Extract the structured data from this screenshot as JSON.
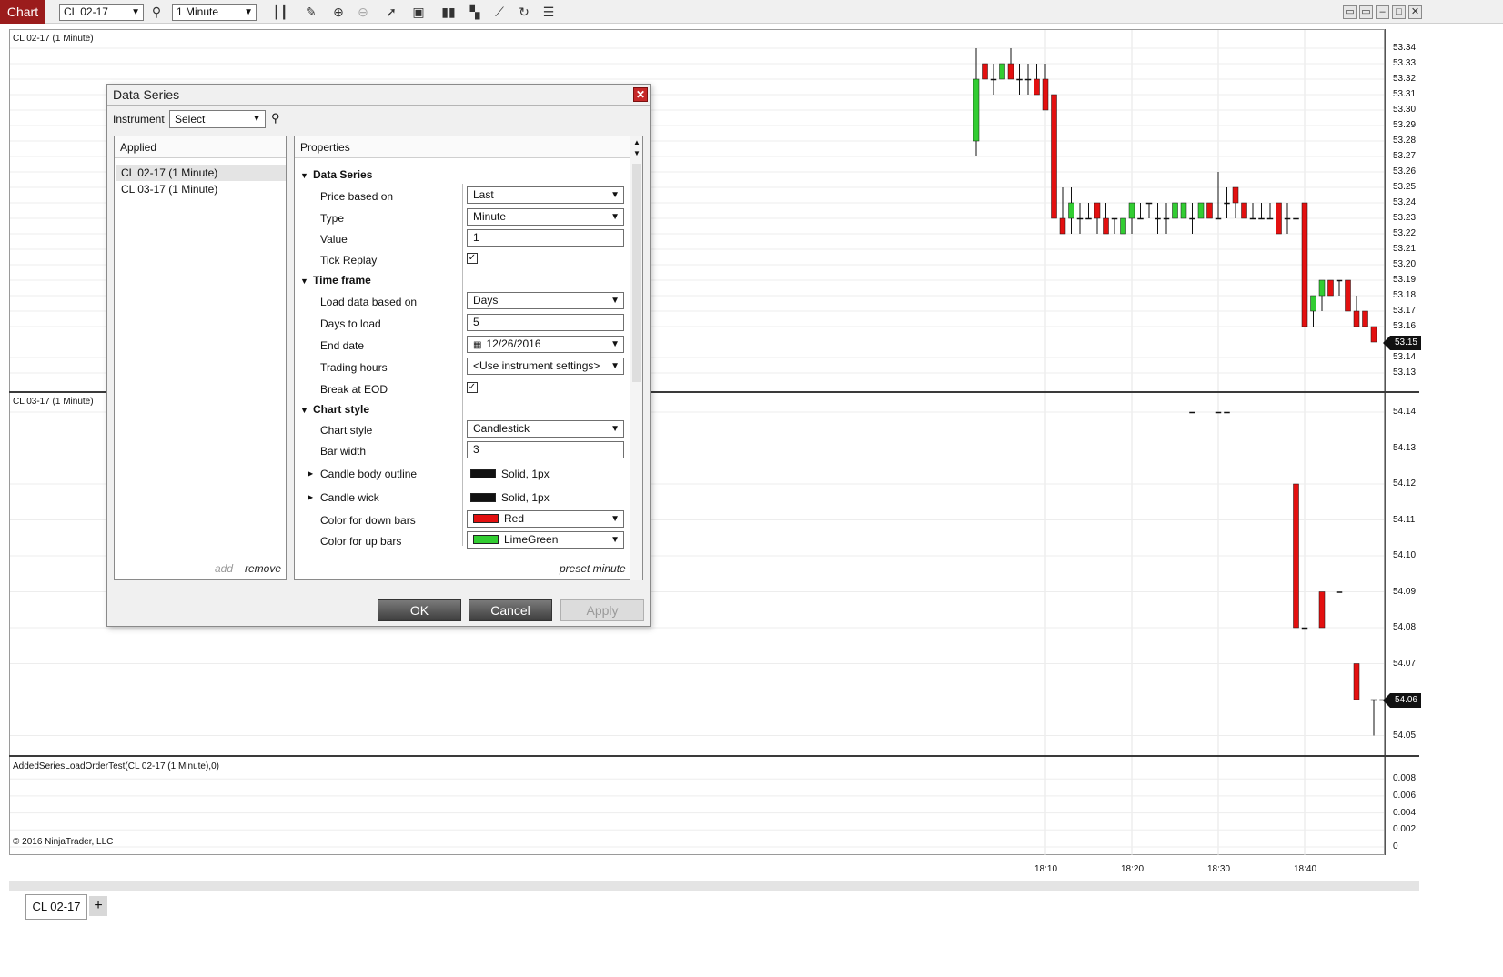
{
  "toolbar": {
    "chart_label": "Chart",
    "instrument": "CL 02-17",
    "interval": "1 Minute",
    "icons": [
      "search-icon",
      "bars-type-icon",
      "pencil-icon",
      "zoom-in-icon",
      "zoom-out-icon",
      "pointer-icon",
      "data-series-icon",
      "strategies-icon",
      "indicators-icon",
      "drawing-tools-icon",
      "reload-icon",
      "properties-icon"
    ]
  },
  "panes": {
    "pane1_label": "CL 02-17 (1 Minute)",
    "pane2_label": "CL 03-17 (1 Minute)",
    "pane3_label": "AddedSeriesLoadOrderTest(CL 02-17 (1 Minute),0)",
    "copyright": "© 2016 NinjaTrader, LLC"
  },
  "axes": {
    "pane1_ticks": [
      "53.34",
      "53.33",
      "53.32",
      "53.31",
      "53.30",
      "53.29",
      "53.28",
      "53.27",
      "53.26",
      "53.25",
      "53.24",
      "53.23",
      "53.22",
      "53.21",
      "53.20",
      "53.19",
      "53.18",
      "53.17",
      "53.16",
      "53.14",
      "53.13"
    ],
    "pane1_last": "53.15",
    "pane2_ticks": [
      "54.14",
      "54.13",
      "54.12",
      "54.11",
      "54.10",
      "54.09",
      "54.08",
      "54.07",
      "54.05"
    ],
    "pane2_last": "54.06",
    "pane3_ticks": [
      "0.008",
      "0.006",
      "0.004",
      "0.002",
      "0"
    ],
    "time_ticks": [
      "18:10",
      "18:20",
      "18:30",
      "18:40"
    ]
  },
  "chart_data": [
    {
      "type": "candlestick",
      "title": "CL 02-17 (1 Minute)",
      "ylim": [
        53.12,
        53.345
      ],
      "x": [
        "18:02",
        "18:03",
        "18:04",
        "18:05",
        "18:06",
        "18:07",
        "18:08",
        "18:09",
        "18:10",
        "18:11",
        "18:12",
        "18:13",
        "18:14",
        "18:15",
        "18:16",
        "18:17",
        "18:18",
        "18:19",
        "18:20",
        "18:21",
        "18:22",
        "18:23",
        "18:24",
        "18:25",
        "18:26",
        "18:27",
        "18:28",
        "18:29",
        "18:30",
        "18:31",
        "18:32",
        "18:33",
        "18:34",
        "18:35",
        "18:36",
        "18:37",
        "18:38",
        "18:39",
        "18:40",
        "18:41",
        "18:42",
        "18:43",
        "18:44",
        "18:45",
        "18:46",
        "18:47",
        "18:48"
      ],
      "open": [
        53.28,
        53.33,
        53.32,
        53.32,
        53.33,
        53.32,
        53.32,
        53.32,
        53.32,
        53.31,
        53.23,
        53.23,
        53.23,
        53.23,
        53.24,
        53.23,
        53.23,
        53.22,
        53.23,
        53.23,
        53.24,
        53.23,
        53.23,
        53.23,
        53.23,
        53.23,
        53.23,
        53.24,
        53.23,
        53.24,
        53.25,
        53.24,
        53.23,
        53.23,
        53.23,
        53.24,
        53.23,
        53.23,
        53.24,
        53.17,
        53.18,
        53.19,
        53.19,
        53.19,
        53.17,
        53.17,
        53.16,
        53.15,
        53.14
      ],
      "high": [
        53.34,
        53.33,
        53.33,
        53.33,
        53.34,
        53.33,
        53.33,
        53.33,
        53.33,
        53.31,
        53.25,
        53.25,
        53.24,
        53.24,
        53.24,
        53.24,
        53.23,
        53.23,
        53.24,
        53.24,
        53.24,
        53.24,
        53.24,
        53.24,
        53.24,
        53.24,
        53.24,
        53.24,
        53.26,
        53.25,
        53.25,
        53.24,
        53.24,
        53.24,
        53.24,
        53.24,
        53.24,
        53.24,
        53.23,
        53.18,
        53.19,
        53.19,
        53.19,
        53.19,
        53.18,
        53.17,
        53.16,
        53.16,
        53.16
      ],
      "low": [
        53.27,
        53.32,
        53.31,
        53.32,
        53.32,
        53.31,
        53.31,
        53.31,
        53.31,
        53.22,
        53.22,
        53.22,
        53.22,
        53.23,
        53.22,
        53.22,
        53.22,
        53.22,
        53.22,
        53.23,
        53.23,
        53.22,
        53.22,
        53.23,
        53.23,
        53.22,
        53.23,
        53.23,
        53.23,
        53.23,
        53.23,
        53.23,
        53.23,
        53.23,
        53.23,
        53.22,
        53.22,
        53.22,
        53.16,
        53.16,
        53.17,
        53.18,
        53.18,
        53.17,
        53.16,
        53.16,
        53.15,
        53.13,
        53.13
      ],
      "close": [
        53.32,
        53.32,
        53.32,
        53.33,
        53.32,
        53.32,
        53.32,
        53.31,
        53.3,
        53.23,
        53.22,
        53.24,
        53.23,
        53.23,
        53.23,
        53.22,
        53.23,
        53.23,
        53.24,
        53.23,
        53.24,
        53.23,
        53.23,
        53.24,
        53.24,
        53.23,
        53.24,
        53.23,
        53.23,
        53.24,
        53.24,
        53.23,
        53.23,
        53.23,
        53.23,
        53.22,
        53.23,
        53.23,
        53.16,
        53.18,
        53.19,
        53.18,
        53.19,
        53.17,
        53.16,
        53.16,
        53.15,
        53.15,
        53.15
      ]
    },
    {
      "type": "candlestick",
      "title": "CL 03-17 (1 Minute)",
      "ylim": [
        54.045,
        54.145
      ],
      "x": [
        "18:27",
        "18:30",
        "18:31",
        "18:39",
        "18:40",
        "18:42",
        "18:44",
        "18:46",
        "18:48",
        "18:49"
      ],
      "open": [
        54.14,
        54.14,
        54.14,
        54.12,
        54.08,
        54.09,
        54.09,
        54.07,
        54.06,
        54.06
      ],
      "high": [
        54.14,
        54.14,
        54.14,
        54.12,
        54.08,
        54.09,
        54.09,
        54.07,
        54.06,
        54.06
      ],
      "low": [
        54.14,
        54.14,
        54.14,
        54.08,
        54.08,
        54.08,
        54.09,
        54.06,
        54.05,
        54.06
      ],
      "close": [
        54.14,
        54.14,
        54.14,
        54.08,
        54.08,
        54.08,
        54.09,
        54.06,
        54.06,
        54.06
      ]
    }
  ],
  "colors": {
    "up": "#32cd32",
    "down": "#e31010",
    "wick": "#111111"
  },
  "dialog": {
    "title": "Data Series",
    "instrument_label": "Instrument",
    "instrument_value": "Select",
    "applied_header": "Applied",
    "applied_items": [
      "CL 02-17 (1 Minute)",
      "CL 03-17 (1 Minute)"
    ],
    "add_label": "add",
    "remove_label": "remove",
    "properties_header": "Properties",
    "preset_label": "preset minute",
    "sections": {
      "data_series": "Data Series",
      "time_frame": "Time frame",
      "chart_style": "Chart style"
    },
    "props": {
      "price_based_on": {
        "label": "Price based on",
        "value": "Last"
      },
      "type": {
        "label": "Type",
        "value": "Minute"
      },
      "value": {
        "label": "Value",
        "value": "1"
      },
      "tick_replay": {
        "label": "Tick Replay",
        "checked": "✓"
      },
      "load_data_based_on": {
        "label": "Load data based on",
        "value": "Days"
      },
      "days_to_load": {
        "label": "Days to load",
        "value": "5"
      },
      "end_date": {
        "label": "End date",
        "value": "12/26/2016"
      },
      "trading_hours": {
        "label": "Trading hours",
        "value": "<Use instrument settings>"
      },
      "break_at_eod": {
        "label": "Break at EOD",
        "checked": "✓"
      },
      "chart_style": {
        "label": "Chart style",
        "value": "Candlestick"
      },
      "bar_width": {
        "label": "Bar width",
        "value": "3"
      },
      "candle_body_outline": {
        "label": "Candle body outline",
        "value": "Solid, 1px"
      },
      "candle_wick": {
        "label": "Candle wick",
        "value": "Solid, 1px"
      },
      "color_down": {
        "label": "Color for down bars",
        "value": "Red",
        "color": "#e31010"
      },
      "color_up": {
        "label": "Color for up bars",
        "value": "LimeGreen",
        "color": "#32cd32"
      }
    },
    "ok_label": "OK",
    "cancel_label": "Cancel",
    "apply_label": "Apply"
  },
  "tabs": {
    "active": "CL 02-17",
    "add": "+"
  }
}
